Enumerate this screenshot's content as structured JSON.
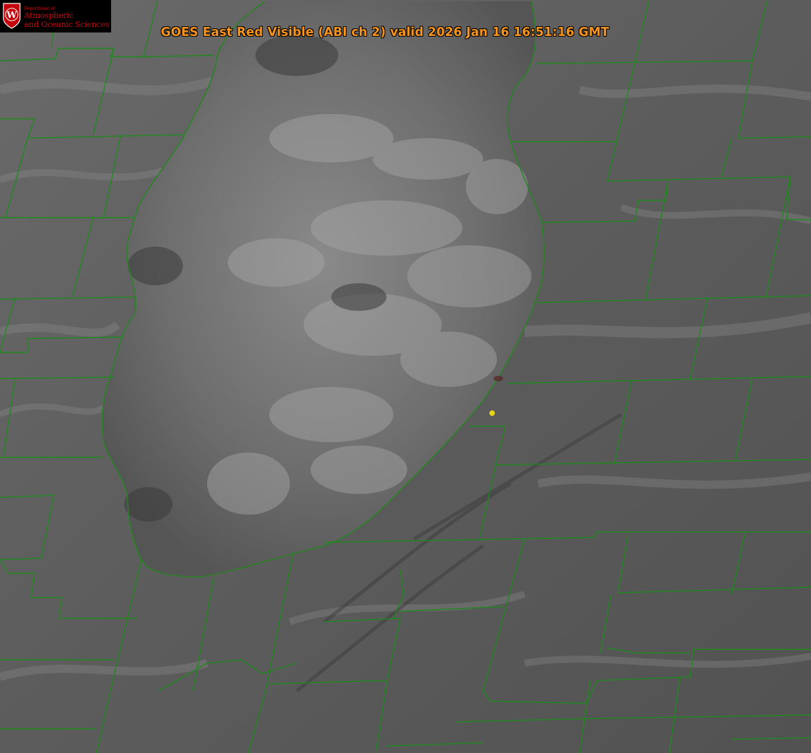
{
  "title": "GOES East Red Visible (ABI ch 2) valid 2026 Jan 16 16:51:16 GMT",
  "logo": {
    "department": "Department of",
    "line1": "Atmospheric",
    "line2": "and Oceanic Sciences",
    "shield_letter": "W"
  },
  "colors": {
    "title": "#f7941d",
    "county_lines": "#1e8a1e",
    "lake_outline": "#c03030",
    "marker": "#e6d619",
    "logo_red": "#c5050c"
  }
}
